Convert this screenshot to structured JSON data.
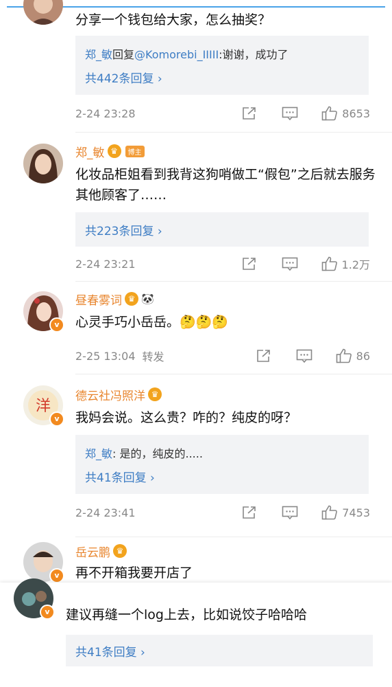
{
  "comments": [
    {
      "text": "分享一个钱包给大家，怎么抽奖？",
      "reply_preview": {
        "name": "郑_敏",
        "verb": "回复",
        "mention": "@Komorebi_IIIII",
        "content": ":谢谢，成功了"
      },
      "more_replies": "共442条回复 ›",
      "time": "2-24 23:28",
      "likes": "8653"
    },
    {
      "name": "郑_敏",
      "badge": "博主",
      "text": "化妆品柜姐看到我背这狗哨做工“假包”之后就去服务其他顾客了……",
      "more_replies": "共223条回复 ›",
      "time": "2-24 23:21",
      "likes": "1.2万"
    },
    {
      "name": "昼春雾词",
      "text": "心灵手巧小岳岳。🤔🤔🤔",
      "time": "2-25 13:04",
      "forward": "转发",
      "likes": "86"
    },
    {
      "name": "德云社冯照洋",
      "text": "我妈会说。这么贵？咋的？纯皮的呀？",
      "reply_preview": {
        "name": "郑_敏",
        "content": ": 是的，纯皮的....."
      },
      "more_replies": "共41条回复 ›",
      "time": "2-24 23:41",
      "likes": "7453"
    },
    {
      "name": "岳云鹏",
      "text": "再不开箱我要开店了"
    },
    {
      "text": "建议再缝一个log上去，比如说饺子哈哈哈",
      "more_replies": "共41条回复 ›"
    }
  ],
  "icons": {
    "share": "share-icon",
    "comment": "comment-icon",
    "like": "thumb-up-icon",
    "crown": "crown-icon",
    "verified": "v-badge-icon"
  },
  "colors": {
    "name": "#e8862f",
    "link": "#3e7dc4",
    "reply_bg": "#f2f3f5",
    "topline": "#4aa3e8"
  }
}
